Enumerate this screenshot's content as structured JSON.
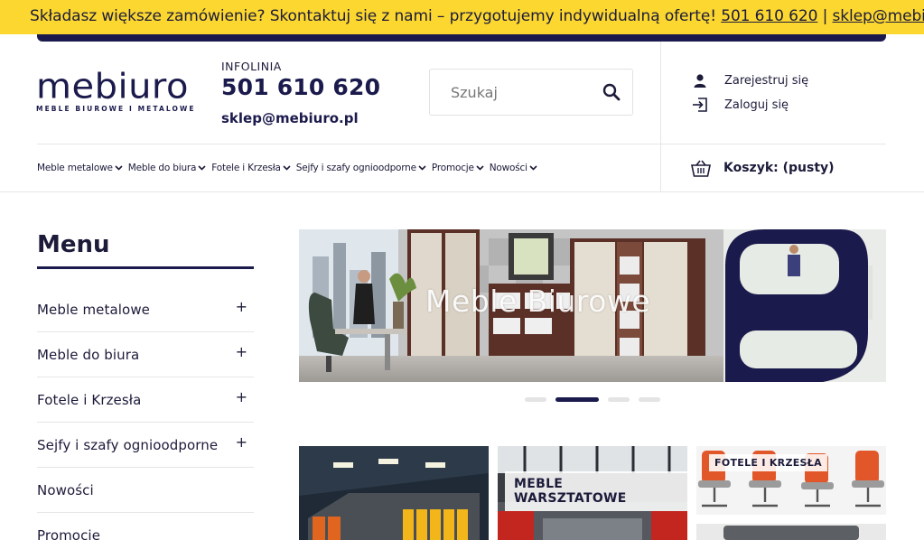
{
  "topbar": {
    "message": "Składasz większe zamówienie? Skontaktuj się z nami – przygotujemy indywidualną ofertę! ",
    "phone": "501 610 620",
    "separator": " | ",
    "email": "sklep@mebiuro.pl"
  },
  "logo": {
    "word": "mebiuro",
    "subtitle": "MEBLE BIUROWE I METALOWE"
  },
  "contact": {
    "label": "INFOLINIA",
    "phone": "501 610 620",
    "email": "sklep@mebiuro.pl"
  },
  "search": {
    "placeholder": "Szukaj",
    "icon": "search-icon"
  },
  "account": {
    "register_label": "Zarejestruj się",
    "register_icon": "user-icon",
    "login_label": "Zaloguj się",
    "login_icon": "login-icon"
  },
  "nav": {
    "items": [
      {
        "label": "Meble metalowe"
      },
      {
        "label": "Meble do biura"
      },
      {
        "label": "Fotele i Krzesła"
      },
      {
        "label": "Sejfy i szafy ognioodporne"
      },
      {
        "label": "Promocje"
      },
      {
        "label": "Nowości"
      }
    ]
  },
  "cart": {
    "label": "Koszyk: (pusty)",
    "icon": "basket-icon"
  },
  "sidebar": {
    "title": "Menu",
    "items": [
      {
        "label": "Meble metalowe",
        "expandable": "+"
      },
      {
        "label": "Meble do biura",
        "expandable": "+"
      },
      {
        "label": "Fotele i Krzesła",
        "expandable": "+"
      },
      {
        "label": "Sejfy i szafy ognioodporne",
        "expandable": "+"
      },
      {
        "label": "Nowości",
        "expandable": ""
      },
      {
        "label": "Promocje",
        "expandable": ""
      }
    ]
  },
  "slider": {
    "caption": "Meble Biurowe",
    "slide_count": 4,
    "active_slide": 2
  },
  "tiles": [
    {
      "label": ""
    },
    {
      "label": "MEBLE WARSZTATOWE"
    },
    {
      "label": "FOTELE I KRZESŁA"
    }
  ],
  "colors": {
    "brand_navy": "#1b1a4c",
    "topbar_yellow": "#fcd730",
    "text": "#1c1b3a"
  }
}
